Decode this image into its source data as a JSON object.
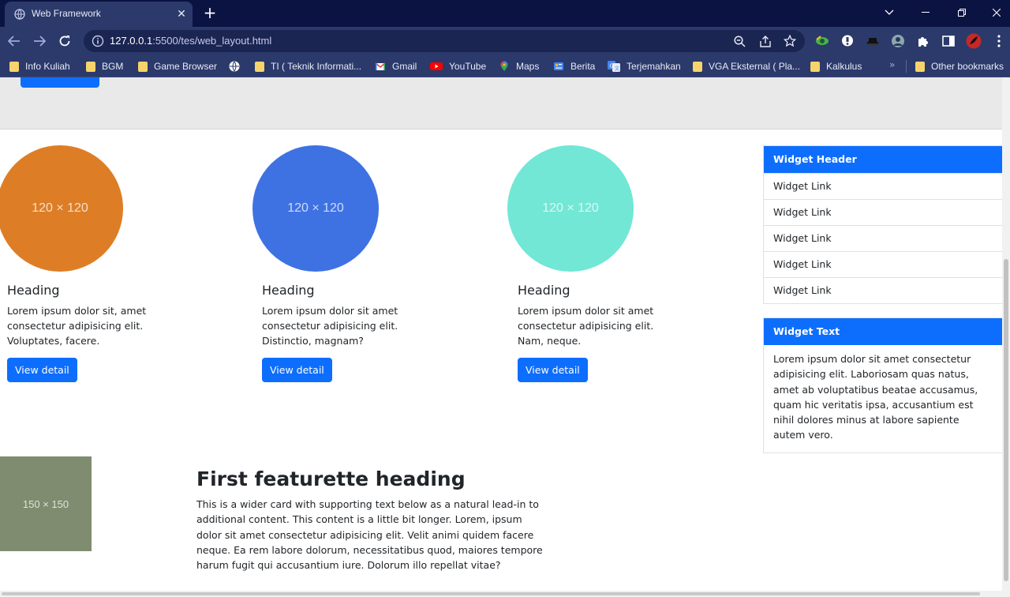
{
  "browser": {
    "tab_title": "Web Framework",
    "url_host": "127.0.0.1",
    "url_rest": ":5500/tes/web_layout.html",
    "bookmarks": [
      {
        "label": "Info Kuliah",
        "icon": "folder-icon"
      },
      {
        "label": "BGM",
        "icon": "folder-icon"
      },
      {
        "label": "Game Browser",
        "icon": "folder-icon"
      },
      {
        "label": "",
        "icon": "globe-icon"
      },
      {
        "label": "TI ( Teknik Informati...",
        "icon": "folder-icon"
      },
      {
        "label": "Gmail",
        "icon": "gmail-icon"
      },
      {
        "label": "YouTube",
        "icon": "youtube-icon"
      },
      {
        "label": "Maps",
        "icon": "maps-icon"
      },
      {
        "label": "Berita",
        "icon": "news-icon"
      },
      {
        "label": "Terjemahkan",
        "icon": "translate-icon"
      },
      {
        "label": "VGA Eksternal ( Pla...",
        "icon": "folder-icon"
      },
      {
        "label": "Kalkulus",
        "icon": "folder-icon"
      }
    ],
    "more_bookmarks": "»",
    "other_bookmarks": "Other bookmarks"
  },
  "page": {
    "columns": [
      {
        "placeholder": "120 × 120",
        "color": "#dd7e26",
        "heading": "Heading",
        "text": "Lorem ipsum dolor sit, amet consectetur adipisicing elit. Voluptates, facere.",
        "button": "View detail"
      },
      {
        "placeholder": "120 × 120",
        "color": "#3e72e3",
        "heading": "Heading",
        "text": "Lorem ipsum dolor sit amet consectetur adipisicing elit. Distinctio, magnam?",
        "button": "View detail"
      },
      {
        "placeholder": "120 × 120",
        "color": "#72e7d6",
        "heading": "Heading",
        "text": "Lorem ipsum dolor sit amet consectetur adipisicing elit. Nam, neque.",
        "button": "View detail"
      }
    ],
    "widget_links": {
      "header": "Widget Header",
      "links": [
        "Widget Link",
        "Widget Link",
        "Widget Link",
        "Widget Link",
        "Widget Link"
      ]
    },
    "widget_text": {
      "header": "Widget Text",
      "text": "Lorem ipsum dolor sit amet consectetur adipisicing elit. Laboriosam quas natus, amet ab voluptatibus beatae accusamus, quam hic veritatis ipsa, accusantium est nihil dolores minus at labore sapiente autem vero."
    },
    "featurette": {
      "placeholder": "150 × 150",
      "heading": "First featurette heading",
      "text": "This is a wider card with supporting text below as a natural lead-in to additional content. This content is a little bit longer. Lorem, ipsum dolor sit amet consectetur adipisicing elit. Velit animi quidem facere neque. Ea rem labore dolorum, necessitatibus quod, maiores tempore harum fugit qui accusantium iure. Dolorum illo repellat vitae?"
    },
    "colors": {
      "primary": "#0d6efd",
      "jumbotron": "#e9e9e9",
      "feat_img": "#7f8c6f"
    }
  }
}
